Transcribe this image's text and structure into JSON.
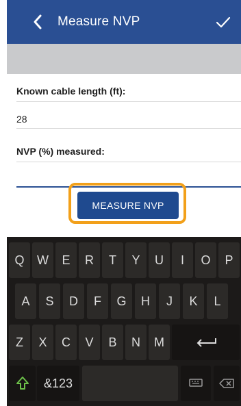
{
  "appbar": {
    "title": "Measure NVP",
    "back_icon": "chevron-left-icon",
    "confirm_icon": "checkmark-icon",
    "color": "#2a4f93"
  },
  "form": {
    "known_length_label": "Known cable length (ft):",
    "known_length_value": "28",
    "nvp_label": "NVP (%) measured:",
    "nvp_value": ""
  },
  "measure_button": {
    "label": "MEASURE NVP",
    "highlight_color": "#f2a01a"
  },
  "keyboard": {
    "row1": [
      "Q",
      "W",
      "E",
      "R",
      "T",
      "Y",
      "U",
      "I",
      "O",
      "P"
    ],
    "row2": [
      "A",
      "S",
      "D",
      "F",
      "G",
      "H",
      "J",
      "K",
      "L"
    ],
    "row3": [
      "Z",
      "X",
      "C",
      "V",
      "B",
      "N",
      "M"
    ],
    "symbols_label": "&123",
    "enter_icon": "enter-arrow-icon",
    "shift_icon": "shift-arrow-icon",
    "hide_keyboard_icon": "keyboard-icon",
    "backspace_icon": "backspace-icon"
  }
}
